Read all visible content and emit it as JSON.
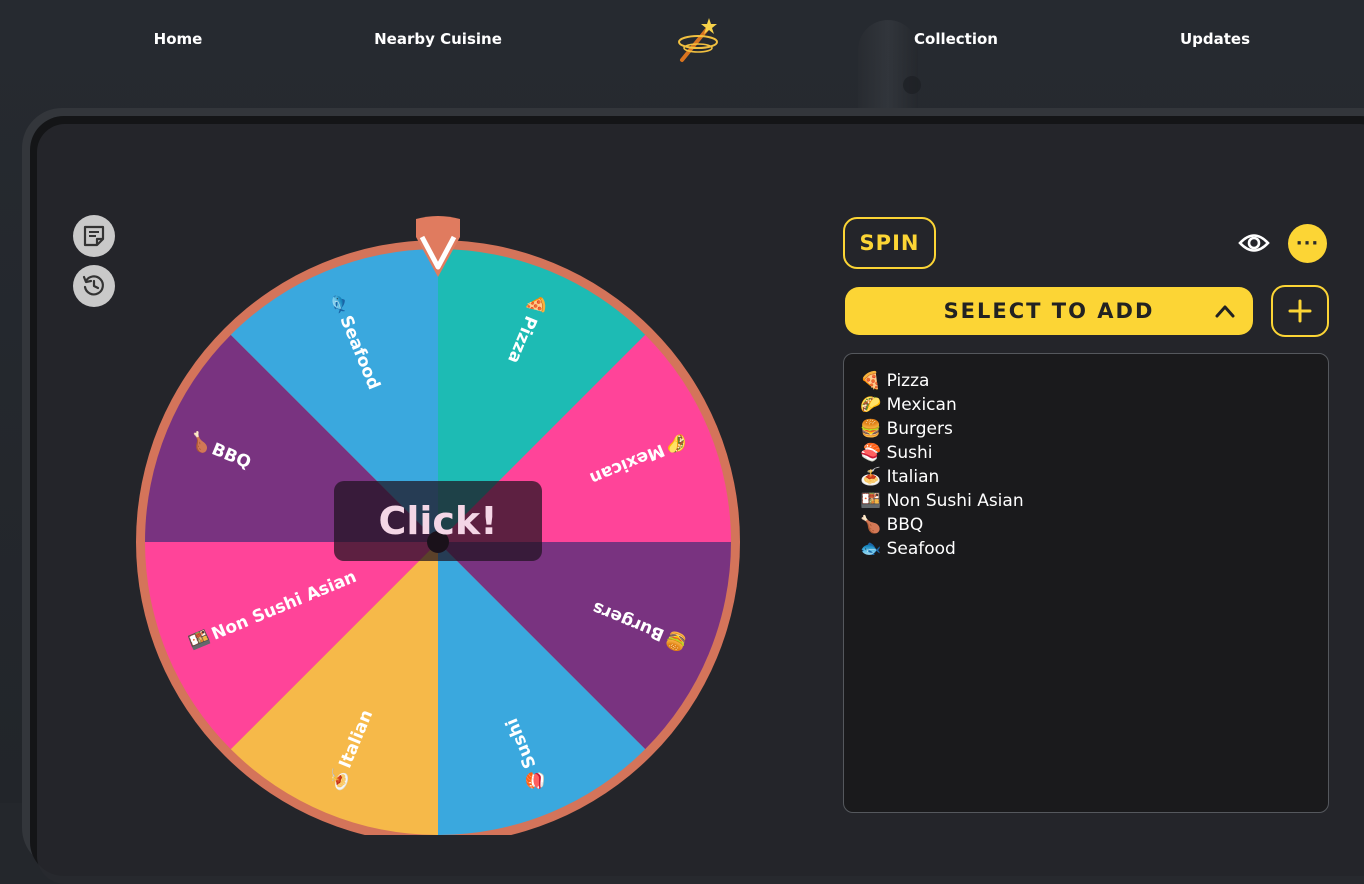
{
  "nav": {
    "items": [
      {
        "label": "Home"
      },
      {
        "label": "Nearby Cuisine"
      },
      {
        "label": "Collection"
      },
      {
        "label": "Updates"
      }
    ]
  },
  "wheel": {
    "center_label": "Click!",
    "pointer_color": "#e07b5f",
    "rim_color": "#d4745a",
    "slices": [
      {
        "label": "Pizza",
        "icon": "pizza-icon",
        "color": "#1dbbb4"
      },
      {
        "label": "Mexican",
        "icon": "taco-icon",
        "color": "#ff4499"
      },
      {
        "label": "Burgers",
        "icon": "burger-icon",
        "color": "#793380"
      },
      {
        "label": "Sushi",
        "icon": "sushi-icon",
        "color": "#3aa8de"
      },
      {
        "label": "Italian",
        "icon": "spaghetti-icon",
        "color": "#f6b949"
      },
      {
        "label": "Non Sushi Asian",
        "icon": "bento-icon",
        "color": "#ff4499"
      },
      {
        "label": "BBQ",
        "icon": "drumstick-icon",
        "color": "#793380"
      },
      {
        "label": "Seafood",
        "icon": "fish-icon",
        "color": "#3aa8de"
      }
    ]
  },
  "controls": {
    "spin_label": "SPIN",
    "more_label": "···",
    "select_label": "SELECT TO ADD"
  },
  "list": {
    "text": "🍕 Pizza\n🌮 Mexican\n🍔 Burgers\n🍣 Sushi\n🍝 Italian\n🍱 Non Sushi Asian\n🍗 BBQ\n🐟 Seafood"
  },
  "colors": {
    "accent": "#fcd535"
  }
}
